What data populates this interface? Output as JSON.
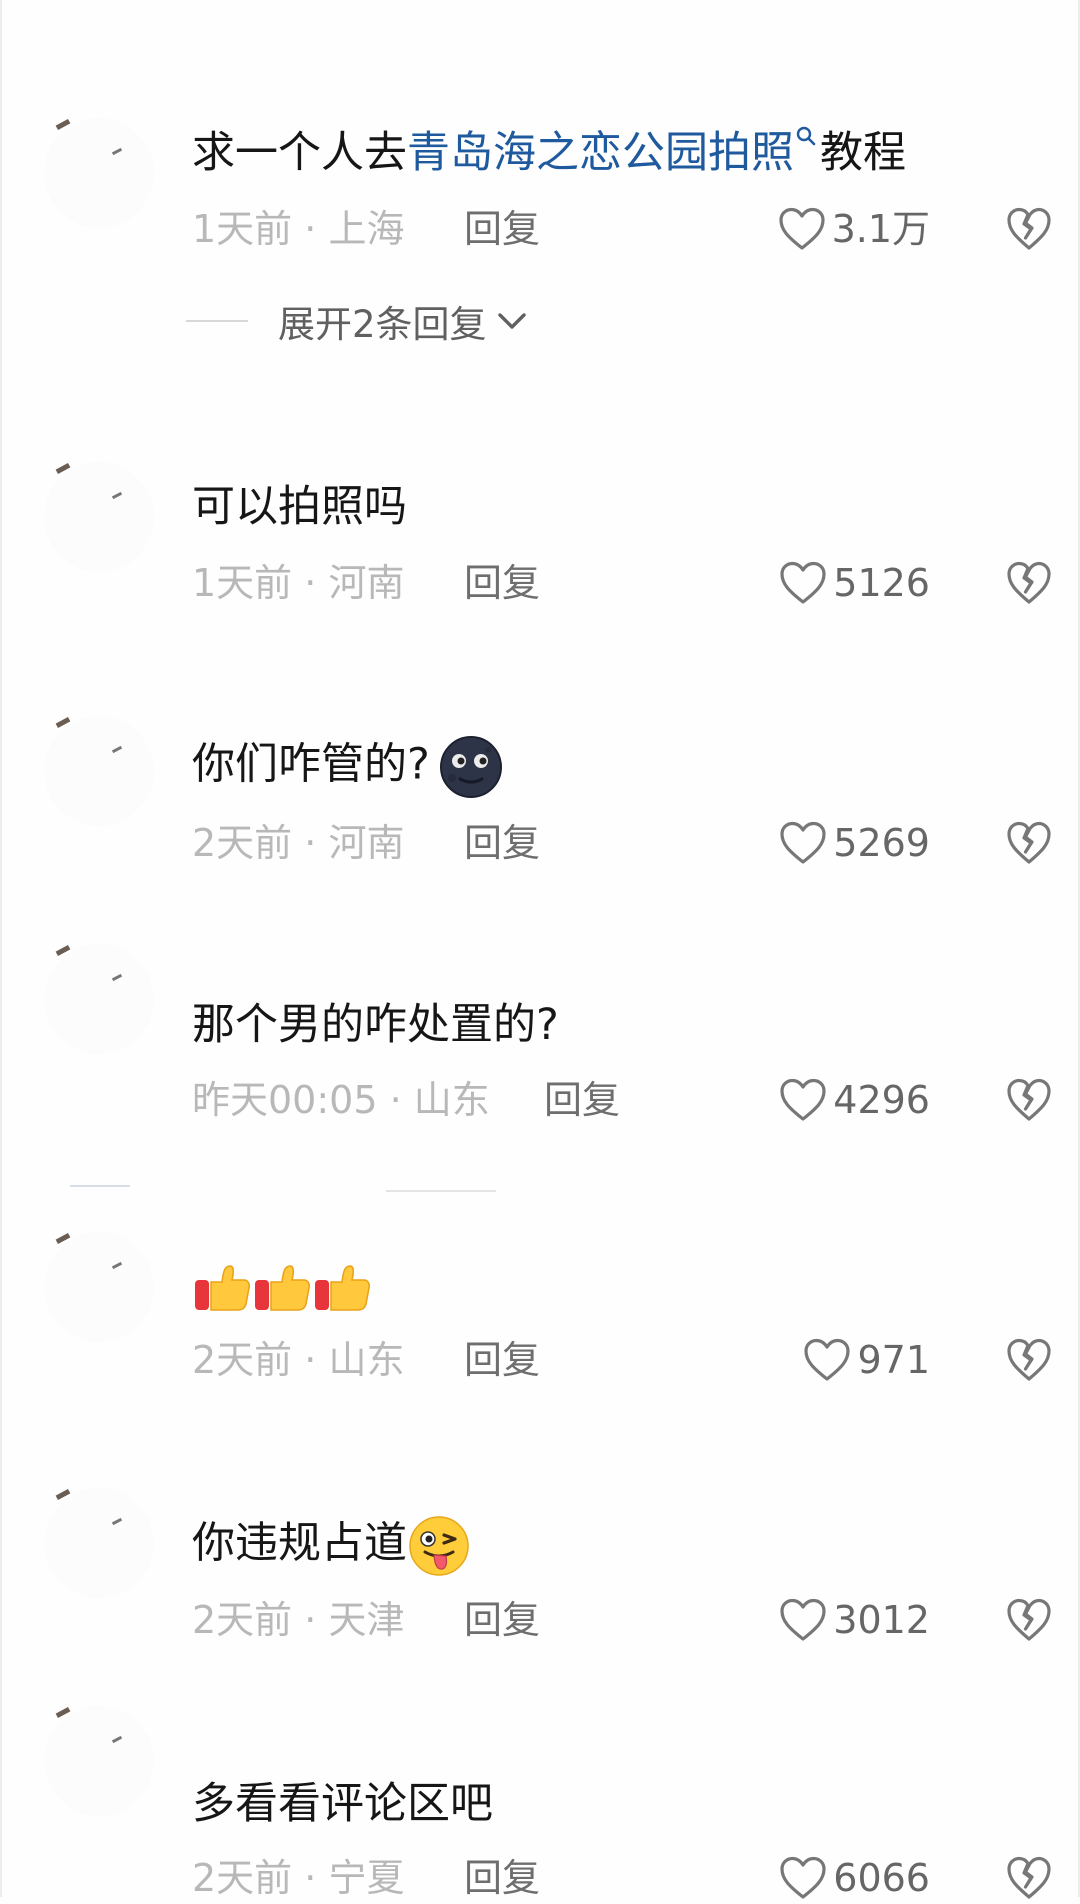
{
  "comments": [
    {
      "text_parts": [
        "求一个人去",
        "青岛海之恋公园拍照",
        "教程"
      ],
      "time": "1天前",
      "location": "上海",
      "reply_label": "回复",
      "likes": "3.1万",
      "expand_label": "展开2条回复"
    },
    {
      "text": "可以拍照吗",
      "time": "1天前",
      "location": "河南",
      "reply_label": "回复",
      "likes": "5126"
    },
    {
      "text": "你们咋管的?",
      "emoji": "new-moon-face",
      "time": "2天前",
      "location": "河南",
      "reply_label": "回复",
      "likes": "5269"
    },
    {
      "text": "那个男的咋处置的?",
      "time": "昨天00:05",
      "location": "山东",
      "reply_label": "回复",
      "likes": "4296"
    },
    {
      "emoji": "thumbs-up x3",
      "time": "2天前",
      "location": "山东",
      "reply_label": "回复",
      "likes": "971"
    },
    {
      "text": "你违规占道",
      "emoji": "winking-tongue-face",
      "time": "2天前",
      "location": "天津",
      "reply_label": "回复",
      "likes": "3012"
    },
    {
      "text": "多看看评论区吧",
      "time": "2天前",
      "location": "宁夏",
      "reply_label": "回复",
      "likes": "6066"
    }
  ],
  "separator": " · ",
  "colors": {
    "link": "#1f5a9e",
    "meta": "#b8b8b8",
    "text": "#161616"
  }
}
